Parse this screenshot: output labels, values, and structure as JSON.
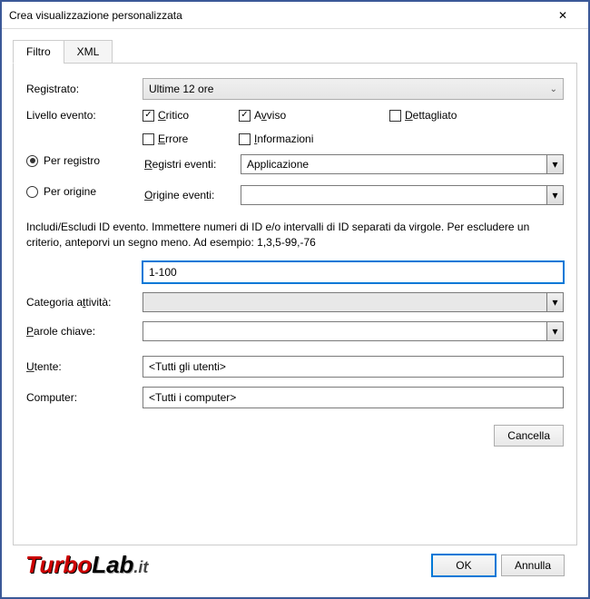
{
  "title": "Crea visualizzazione personalizzata",
  "tabs": {
    "filtro": "Filtro",
    "xml": "XML"
  },
  "labels": {
    "registrato": "Registrato:",
    "livello": "Livello evento:",
    "per_registro": "Per registro",
    "per_origine": "Per origine",
    "registri_eventi": "Registri eventi:",
    "origine_eventi": "Origine eventi:",
    "help": "Includi/Escludi ID evento. Immettere numeri di ID e/o intervalli di ID separati da virgole. Per escludere un criterio, anteporvi un segno meno. Ad esempio: 1,3,5-99,-76",
    "categoria": "Categoria attività:",
    "parole": "Parole chiave:",
    "utente": "Utente:",
    "computer": "Computer:"
  },
  "values": {
    "registrato": "Ultime 12 ore",
    "registri_eventi": "Applicazione",
    "origine_eventi": "",
    "id_evento": "1-100",
    "categoria": "",
    "parole": "",
    "utente": "<Tutti gli utenti>",
    "computer": "<Tutti i computer>"
  },
  "checkboxes": {
    "critico": "Critico",
    "avviso": "Avviso",
    "dettagliato": "Dettagliato",
    "errore": "Errore",
    "informazioni": "Informazioni"
  },
  "buttons": {
    "cancella": "Cancella",
    "ok": "OK",
    "annulla": "Annulla"
  },
  "logo": {
    "turbo": "Turbo",
    "lab": "Lab",
    "it": ".it"
  }
}
